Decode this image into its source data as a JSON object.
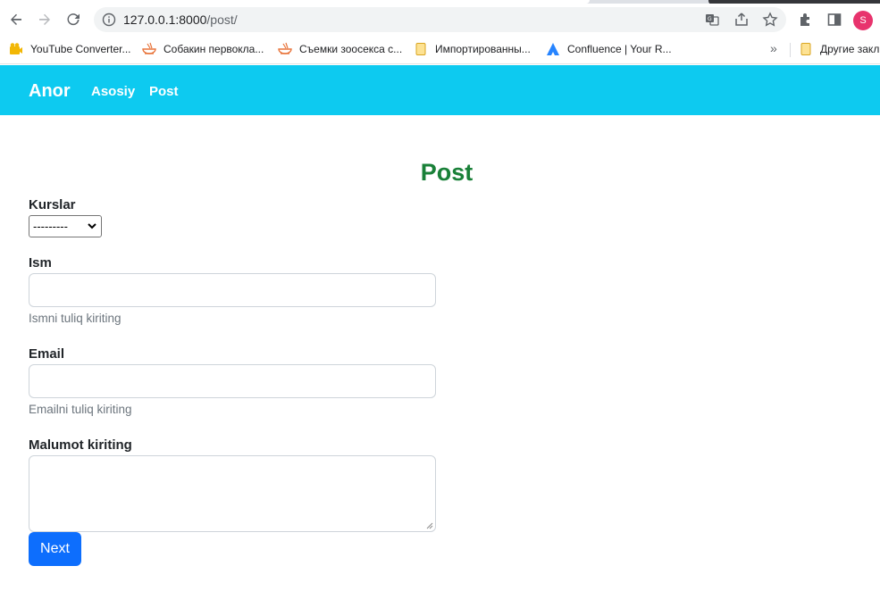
{
  "browser": {
    "url_host": "127.0.0.1:8000",
    "url_path": "/post/",
    "profile_initial": "S",
    "bookmarks": [
      {
        "label": "YouTube Converter...",
        "icon": "youtube-converter-icon"
      },
      {
        "label": "Собакин первокла...",
        "icon": "bowl-icon"
      },
      {
        "label": "Съемки зоосекса с...",
        "icon": "bowl-icon"
      },
      {
        "label": "Импортированны...",
        "icon": "folder-icon"
      },
      {
        "label": "Confluence | Your R...",
        "icon": "confluence-icon"
      }
    ],
    "more_bookmarks_label": "»",
    "other_bookmarks_label": "Другие закл"
  },
  "navbar": {
    "brand": "Anor",
    "links": [
      "Asosiy",
      "Post"
    ]
  },
  "page": {
    "title": "Post"
  },
  "form": {
    "kurslar_label": "Kurslar",
    "kurslar_selected": "---------",
    "ism_label": "Ism",
    "ism_value": "",
    "ism_help": "Ismni tuliq kiriting",
    "email_label": "Email",
    "email_value": "",
    "email_help": "Emailni tuliq kiriting",
    "malumot_label": "Malumot kiriting",
    "malumot_value": "",
    "submit_label": "Next"
  },
  "colors": {
    "navbar_bg": "#0dcaf0",
    "title_green": "#198038",
    "button_blue": "#0d6efd",
    "profile_pink": "#e8336d"
  }
}
